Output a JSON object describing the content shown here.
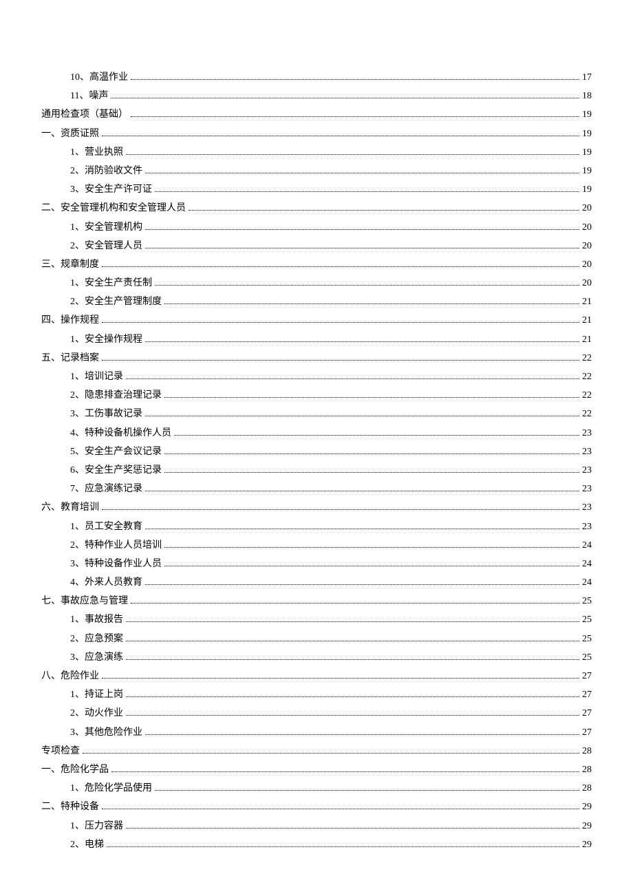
{
  "toc": [
    {
      "level": 2,
      "label": "10、高温作业",
      "page": "17"
    },
    {
      "level": 2,
      "label": "11、噪声",
      "page": "18"
    },
    {
      "level": 0,
      "label": "通用检查项（基础）",
      "page": "19"
    },
    {
      "level": 0,
      "label": "一、资质证照",
      "page": "19"
    },
    {
      "level": 2,
      "label": "1、营业执照",
      "page": "19"
    },
    {
      "level": 2,
      "label": "2、消防验收文件",
      "page": "19"
    },
    {
      "level": 2,
      "label": "3、安全生产许可证",
      "page": "19"
    },
    {
      "level": 0,
      "label": "二、安全管理机构和安全管理人员",
      "page": "20"
    },
    {
      "level": 2,
      "label": "1、安全管理机构",
      "page": "20"
    },
    {
      "level": 2,
      "label": "2、安全管理人员",
      "page": "20"
    },
    {
      "level": 0,
      "label": "三、规章制度",
      "page": "20"
    },
    {
      "level": 2,
      "label": "1、安全生产责任制",
      "page": "20"
    },
    {
      "level": 2,
      "label": "2、安全生产管理制度",
      "page": "21"
    },
    {
      "level": 0,
      "label": "四、操作规程",
      "page": "21"
    },
    {
      "level": 2,
      "label": "1、安全操作规程",
      "page": "21"
    },
    {
      "level": 0,
      "label": "五、记录档案",
      "page": "22"
    },
    {
      "level": 2,
      "label": "1、培训记录",
      "page": "22"
    },
    {
      "level": 2,
      "label": "2、隐患排查治理记录",
      "page": "22"
    },
    {
      "level": 2,
      "label": "3、工伤事故记录",
      "page": "22"
    },
    {
      "level": 2,
      "label": "4、特种设备机操作人员",
      "page": "23"
    },
    {
      "level": 2,
      "label": "5、安全生产会议记录",
      "page": "23"
    },
    {
      "level": 2,
      "label": "6、安全生产奖惩记录",
      "page": "23"
    },
    {
      "level": 2,
      "label": "7、应急演练记录",
      "page": "23"
    },
    {
      "level": 0,
      "label": "六、教育培训",
      "page": "23"
    },
    {
      "level": 2,
      "label": "1、员工安全教育",
      "page": "23"
    },
    {
      "level": 2,
      "label": "2、特种作业人员培训",
      "page": "24"
    },
    {
      "level": 2,
      "label": "3、特种设备作业人员",
      "page": "24"
    },
    {
      "level": 2,
      "label": "4、外来人员教育",
      "page": "24"
    },
    {
      "level": 0,
      "label": "七、事故应急与管理",
      "page": "25"
    },
    {
      "level": 2,
      "label": "1、事故报告",
      "page": "25"
    },
    {
      "level": 2,
      "label": "2、应急预案",
      "page": "25"
    },
    {
      "level": 2,
      "label": "3、应急演练",
      "page": "25"
    },
    {
      "level": 0,
      "label": "八、危险作业",
      "page": "27"
    },
    {
      "level": 2,
      "label": "1、持证上岗",
      "page": "27"
    },
    {
      "level": 2,
      "label": "2、动火作业",
      "page": "27"
    },
    {
      "level": 2,
      "label": "3、其他危险作业",
      "page": "27"
    },
    {
      "level": 0,
      "label": "专项检查",
      "page": "28"
    },
    {
      "level": 0,
      "label": "一、危险化学品",
      "page": "28"
    },
    {
      "level": 2,
      "label": "1、危险化学品使用",
      "page": "28"
    },
    {
      "level": 0,
      "label": "二、特种设备",
      "page": "29"
    },
    {
      "level": 2,
      "label": "1、压力容器",
      "page": "29"
    },
    {
      "level": 2,
      "label": "2、电梯",
      "page": "29"
    }
  ]
}
